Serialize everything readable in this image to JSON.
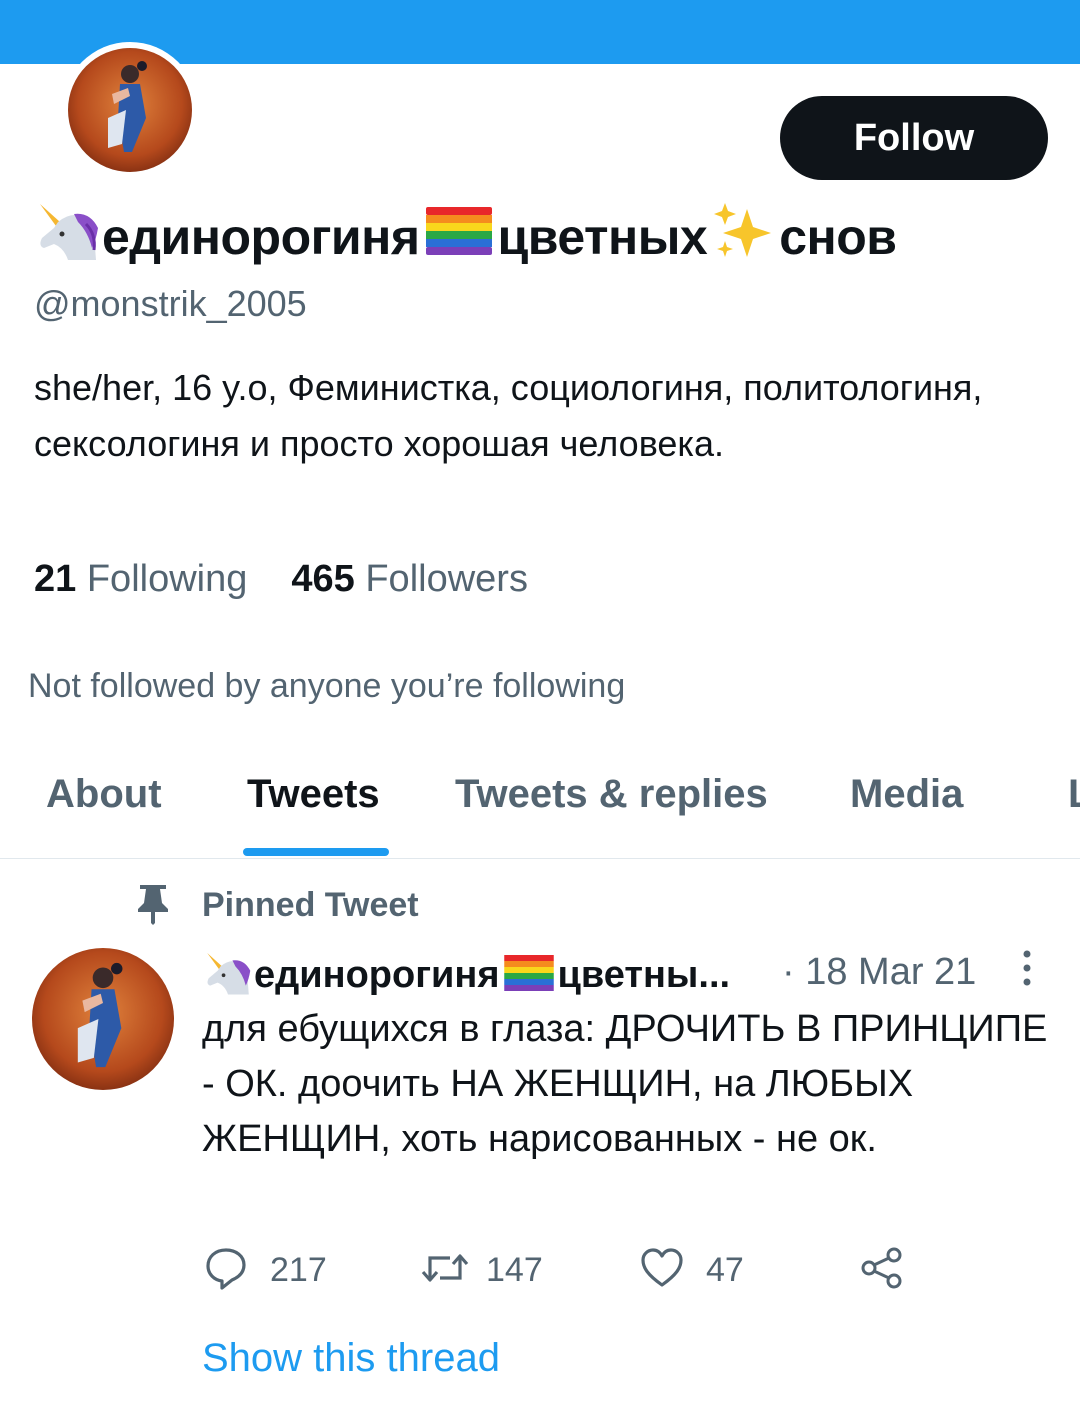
{
  "profile": {
    "name_part1": "единорогиня",
    "name_part2": "цветных",
    "name_part3": "снов",
    "handle": "@monstrik_2005",
    "bio": "she/her, 16 y.o, Феминистка, социологиня, политологиня, сексологиня и просто хорошая человека.",
    "following_count": "21",
    "following_label": "Following",
    "followers_count": "465",
    "followers_label": "Followers",
    "not_followed_text": "Not followed by anyone you’re following"
  },
  "follow_button": {
    "label": "Follow"
  },
  "tabs": [
    {
      "label": "About"
    },
    {
      "label": "Tweets",
      "active": true
    },
    {
      "label": "Tweets & replies"
    },
    {
      "label": "Media"
    },
    {
      "label": "L"
    }
  ],
  "pinned": {
    "label": "Pinned Tweet",
    "author_part1": "единорогиня",
    "author_part2": "цветны...",
    "date": "· 18 Mar 21",
    "text": "для ебущихся в глаза: ДРОЧИТЬ В ПРИНЦИПЕ - ОК. доочить НА ЖЕНЩИН, на ЛЮБЫХ ЖЕНЩИН, хоть нарисованных - не ок.",
    "replies": "217",
    "retweets": "147",
    "likes": "47",
    "show_thread": "Show this thread"
  },
  "icons": [
    "unicorn-emoji",
    "rainbow-flag-emoji",
    "sparkles-emoji",
    "pin-icon",
    "more-icon",
    "reply-icon",
    "retweet-icon",
    "like-icon",
    "share-icon"
  ],
  "colors": {
    "accent": "#1d9bf0",
    "text": "#0f1419",
    "secondary": "#536471",
    "button": "#0f1419"
  }
}
